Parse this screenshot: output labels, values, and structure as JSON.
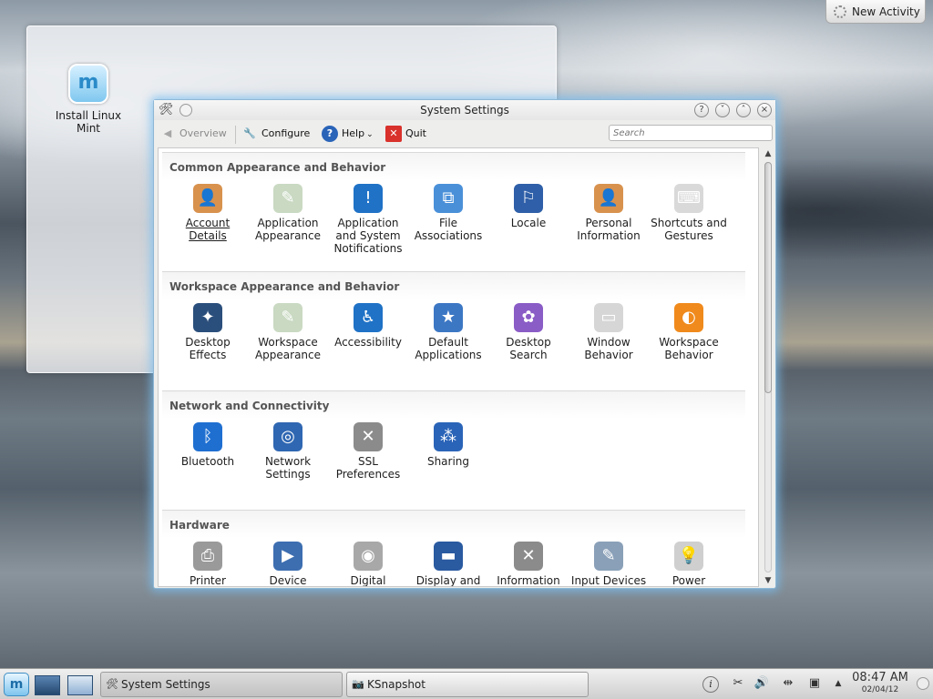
{
  "desktop": {
    "icon_label": "Install Linux Mint",
    "activity_button": "New Activity"
  },
  "window": {
    "title": "System Settings",
    "toolbar": {
      "overview": "Overview",
      "configure": "Configure",
      "help": "Help",
      "quit": "Quit",
      "search_placeholder": "Search"
    },
    "sections": [
      {
        "title": "Common Appearance and Behavior",
        "items": [
          {
            "label": "Account Details",
            "icon": "account-details-icon",
            "color": "#d8924e"
          },
          {
            "label": "Application Appearance",
            "icon": "application-appearance-icon",
            "color": "#c9d9c2"
          },
          {
            "label": "Application and System Notifications",
            "icon": "notifications-icon",
            "color": "#1f72c6"
          },
          {
            "label": "File Associations",
            "icon": "file-associations-icon",
            "color": "#4a90d9"
          },
          {
            "label": "Locale",
            "icon": "locale-flag-icon",
            "color": "#2f5fa8"
          },
          {
            "label": "Personal Information",
            "icon": "personal-information-icon",
            "color": "#d8924e"
          },
          {
            "label": "Shortcuts and Gestures",
            "icon": "keyboard-shortcuts-icon",
            "color": "#d9d9d9"
          }
        ]
      },
      {
        "title": "Workspace Appearance and Behavior",
        "items": [
          {
            "label": "Desktop Effects",
            "icon": "desktop-effects-icon",
            "color": "#2b4f7c"
          },
          {
            "label": "Workspace Appearance",
            "icon": "workspace-appearance-icon",
            "color": "#c9d9c2"
          },
          {
            "label": "Accessibility",
            "icon": "accessibility-icon",
            "color": "#1f72c6"
          },
          {
            "label": "Default Applications",
            "icon": "default-applications-icon",
            "color": "#3c77c4"
          },
          {
            "label": "Desktop Search",
            "icon": "desktop-search-icon",
            "color": "#8a5cc6"
          },
          {
            "label": "Window Behavior",
            "icon": "window-behavior-icon",
            "color": "#d6d6d6"
          },
          {
            "label": "Workspace Behavior",
            "icon": "workspace-behavior-icon",
            "color": "#f08a1c"
          }
        ]
      },
      {
        "title": "Network and Connectivity",
        "items": [
          {
            "label": "Bluetooth",
            "icon": "bluetooth-icon",
            "color": "#1f6fd1"
          },
          {
            "label": "Network Settings",
            "icon": "network-settings-icon",
            "color": "#2f67b2"
          },
          {
            "label": "SSL Preferences",
            "icon": "ssl-preferences-icon",
            "color": "#8b8b8b"
          },
          {
            "label": "Sharing",
            "icon": "sharing-icon",
            "color": "#2a64b8"
          }
        ]
      },
      {
        "title": "Hardware",
        "items": [
          {
            "label": "Printer",
            "icon": "printer-icon",
            "color": "#9a9a9a"
          },
          {
            "label": "Device",
            "icon": "device-actions-icon",
            "color": "#3d6eb0"
          },
          {
            "label": "Digital",
            "icon": "digital-camera-icon",
            "color": "#a8a8a8"
          },
          {
            "label": "Display and",
            "icon": "display-monitor-icon",
            "color": "#2a5aa0"
          },
          {
            "label": "Information",
            "icon": "information-icon",
            "color": "#8b8b8b"
          },
          {
            "label": "Input Devices",
            "icon": "input-devices-icon",
            "color": "#8aa0b8"
          },
          {
            "label": "Power",
            "icon": "power-bulb-icon",
            "color": "#cfcfcf"
          }
        ]
      }
    ]
  },
  "taskbar": {
    "tasks": [
      "System Settings",
      "KSnapshot"
    ],
    "time": "08:47 AM",
    "date": "02/04/12"
  }
}
